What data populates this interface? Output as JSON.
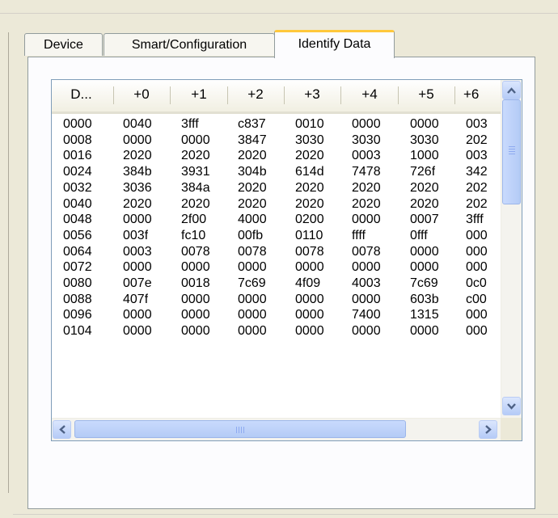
{
  "tabs": [
    {
      "label": "Device"
    },
    {
      "label": "Smart/Configuration"
    },
    {
      "label": "Identify Data",
      "selected": true
    }
  ],
  "table": {
    "columns": [
      "D...",
      "+0",
      "+1",
      "+2",
      "+3",
      "+4",
      "+5",
      "+6"
    ],
    "rows": [
      [
        "0000",
        "0040",
        "3fff",
        "c837",
        "0010",
        "0000",
        "0000",
        "003"
      ],
      [
        "0008",
        "0000",
        "0000",
        "3847",
        "3030",
        "3030",
        "3030",
        "202"
      ],
      [
        "0016",
        "2020",
        "2020",
        "2020",
        "2020",
        "0003",
        "1000",
        "003"
      ],
      [
        "0024",
        "384b",
        "3931",
        "304b",
        "614d",
        "7478",
        "726f",
        "342"
      ],
      [
        "0032",
        "3036",
        "384a",
        "2020",
        "2020",
        "2020",
        "2020",
        "202"
      ],
      [
        "0040",
        "2020",
        "2020",
        "2020",
        "2020",
        "2020",
        "2020",
        "202"
      ],
      [
        "0048",
        "0000",
        "2f00",
        "4000",
        "0200",
        "0000",
        "0007",
        "3fff"
      ],
      [
        "0056",
        "003f",
        "fc10",
        "00fb",
        "0110",
        "ffff",
        "0fff",
        "000"
      ],
      [
        "0064",
        "0003",
        "0078",
        "0078",
        "0078",
        "0078",
        "0000",
        "000"
      ],
      [
        "0072",
        "0000",
        "0000",
        "0000",
        "0000",
        "0000",
        "0000",
        "000"
      ],
      [
        "0080",
        "007e",
        "0018",
        "7c69",
        "4f09",
        "4003",
        "7c69",
        "0c0"
      ],
      [
        "0088",
        "407f",
        "0000",
        "0000",
        "0000",
        "0000",
        "603b",
        "c00"
      ],
      [
        "0096",
        "0000",
        "0000",
        "0000",
        "0000",
        "7400",
        "1315",
        "000"
      ],
      [
        "0104",
        "0000",
        "0000",
        "0000",
        "0000",
        "0000",
        "0000",
        "000"
      ]
    ]
  },
  "icons": {
    "scroll_up": "arrow-up-icon",
    "scroll_down": "arrow-down-icon",
    "scroll_left": "arrow-left-icon",
    "scroll_right": "arrow-right-icon"
  },
  "colors": {
    "window_bg": "#ece9d8",
    "tab_highlight": "#ffc83c",
    "scroll_blue": "#b4cbf6"
  }
}
